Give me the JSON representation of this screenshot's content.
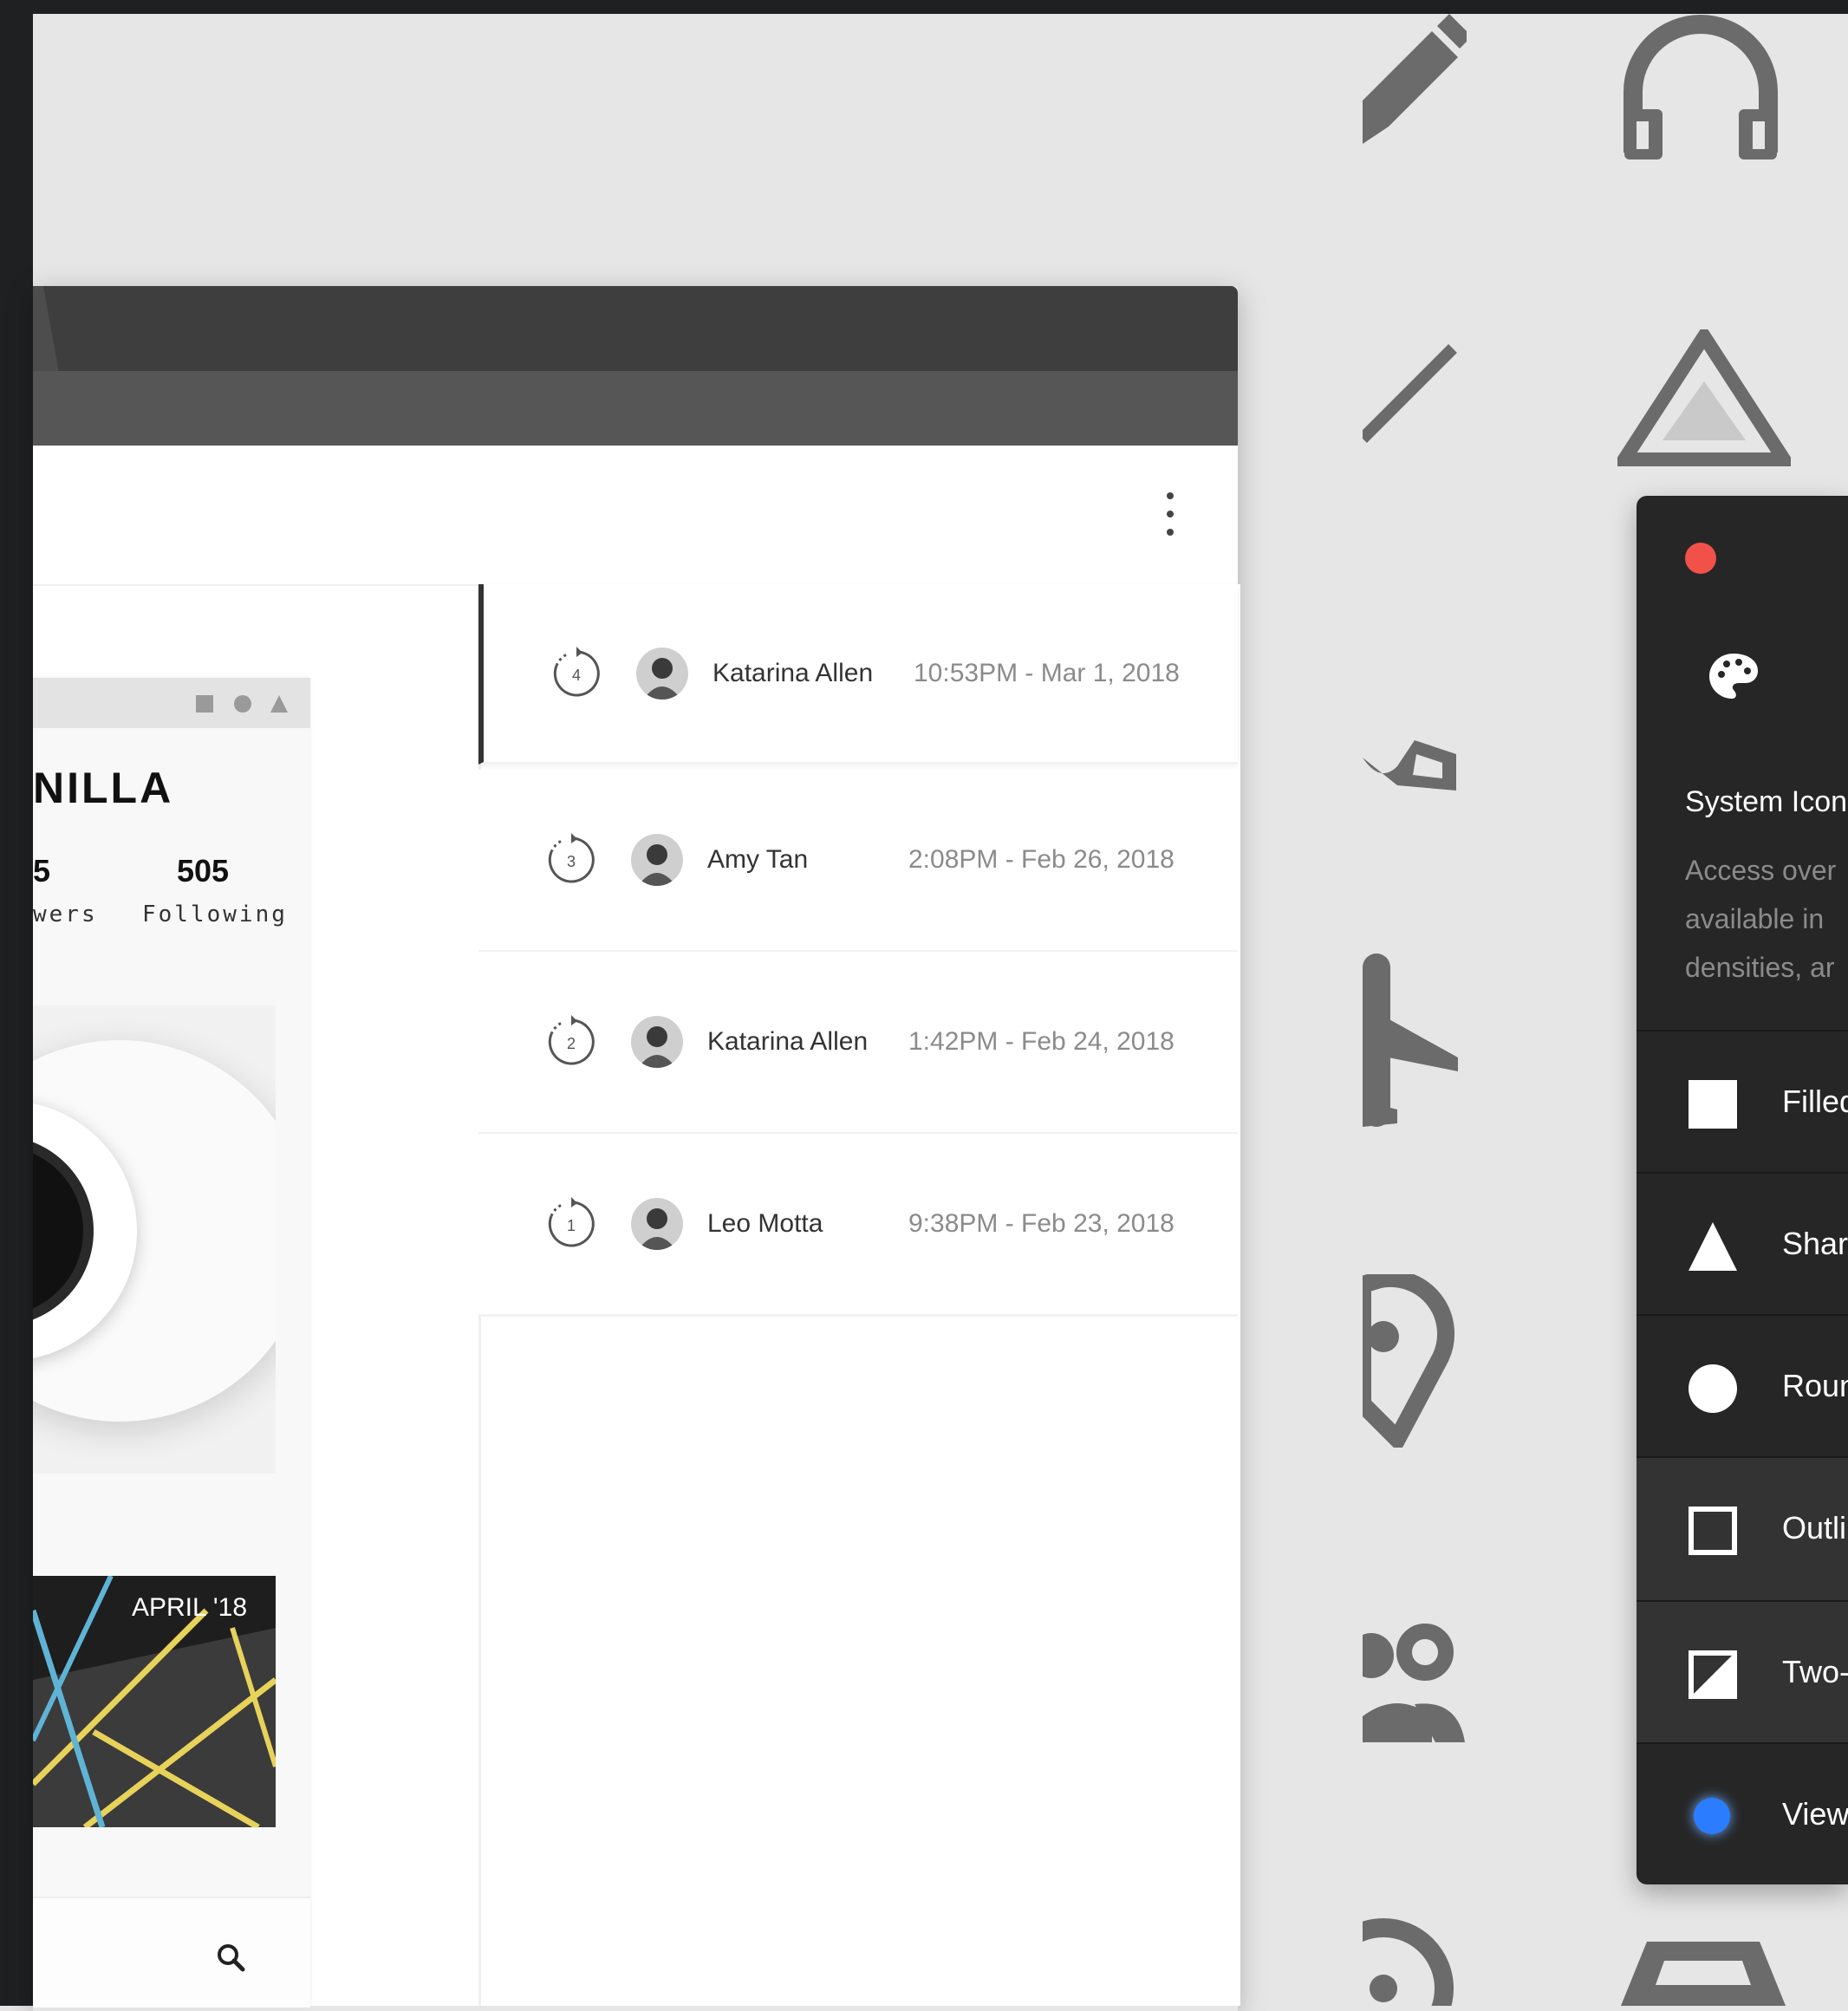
{
  "colors": {
    "background": "#e6e6e6",
    "frame": "#1f2022",
    "browser_chrome": "#3e3e3e",
    "toolbar": "#565656",
    "active_row_border": "#333333",
    "panel_bg": "#262626",
    "close_dot": "#f2514a",
    "view_dot": "#2b7cff",
    "glyph_gray": "#6b6b6b"
  },
  "profile_preview": {
    "title_fragment": "NILLA",
    "stats": [
      {
        "value": "5",
        "label": "wers"
      },
      {
        "value": "505",
        "label": "Following"
      }
    ],
    "photo_label": "APRIL '18",
    "search_icon": "search-icon"
  },
  "version_history": [
    {
      "version": "4",
      "name": "Katarina Allen",
      "time": "10:53PM - Mar 1, 2018",
      "active": true
    },
    {
      "version": "3",
      "name": "Amy Tan",
      "time": "2:08PM - Feb 26, 2018",
      "active": false
    },
    {
      "version": "2",
      "name": "Katarina Allen",
      "time": "1:42PM - Feb 24, 2018",
      "active": false
    },
    {
      "version": "1",
      "name": "Leo Motta",
      "time": "9:38PM - Feb 23, 2018",
      "active": false
    }
  ],
  "background_icons": [
    "pencil-icon",
    "headphones-icon",
    "line-icon",
    "warning-triangle-icon",
    "gesture-icon",
    "flight-icon",
    "location-pin-icon",
    "people-icon",
    "lens-icon",
    "car-icon"
  ],
  "panel": {
    "title": "System Icon",
    "description_lines": [
      "Access over",
      "available in",
      "densities, ar"
    ],
    "options": [
      {
        "label": "Filled",
        "icon": "filled-square-icon"
      },
      {
        "label": "Sharp",
        "icon": "sharp-triangle-icon"
      },
      {
        "label": "Round",
        "icon": "round-circle-icon"
      },
      {
        "label": "Outli",
        "icon": "outline-square-icon"
      },
      {
        "label": "Two-",
        "icon": "two-tone-square-icon"
      },
      {
        "label": "View",
        "icon": "blue-dot-icon"
      }
    ]
  }
}
